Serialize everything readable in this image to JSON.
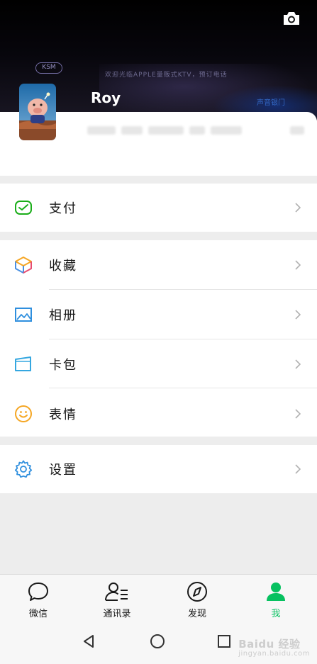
{
  "header": {
    "banner_logo": "KSM",
    "banner_text": "欢迎光临APPLE量贩式KTV，预订电话",
    "banner_tag": "声音银门"
  },
  "profile": {
    "name": "Roy"
  },
  "menu": {
    "pay": "支付",
    "favorites": "收藏",
    "album": "相册",
    "cards": "卡包",
    "stickers": "表情",
    "settings": "设置"
  },
  "tabbar": {
    "chats": "微信",
    "contacts": "通讯录",
    "discover": "发现",
    "me": "我"
  },
  "colors": {
    "accent_green": "#07c160",
    "pay_green": "#1aad19",
    "favorites_multicolor": [
      "#f6a623",
      "#4a90e2",
      "#e74c6f"
    ],
    "album_blue": "#2f8fde",
    "cards_blue": "#35a7e0",
    "stickers_orange": "#f5a623",
    "settings_blue": "#2f8fde"
  },
  "watermark": {
    "brand": "Baidu 经验",
    "sub": "jingyan.baidu.com"
  }
}
